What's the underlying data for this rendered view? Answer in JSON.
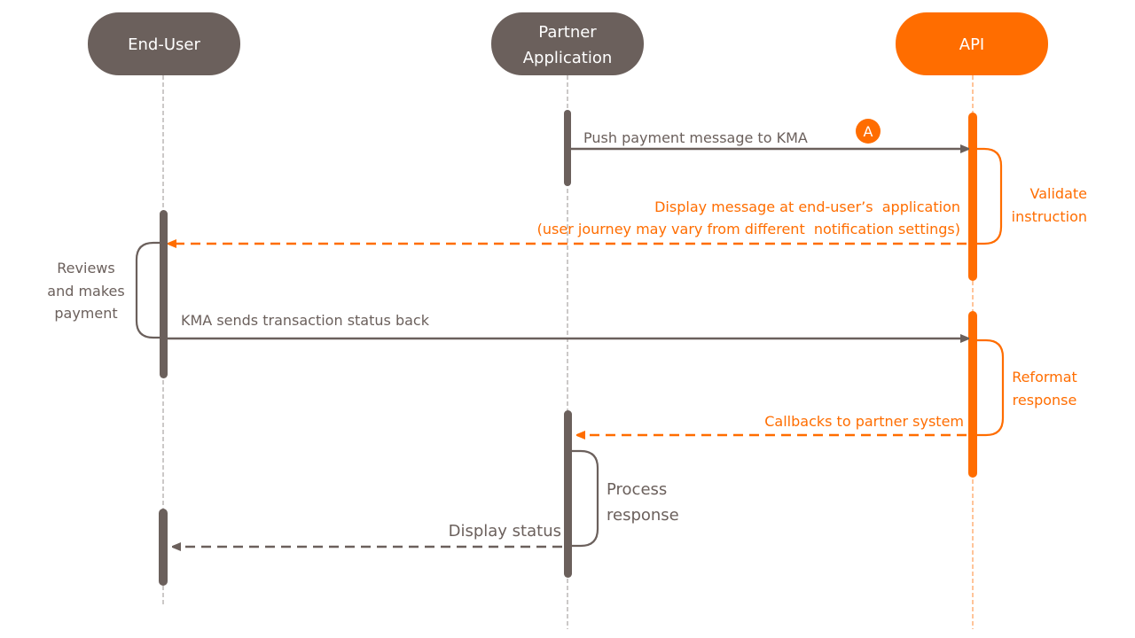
{
  "colors": {
    "gray": "#6b605c",
    "orange": "#ff6d00",
    "white": "#ffffff",
    "lifeline_gray": "#9a9390",
    "lifeline_orange": "#ff8a33"
  },
  "participants": [
    {
      "id": "end-user",
      "name_lines": [
        "End-User"
      ],
      "color": "#6b605c"
    },
    {
      "id": "partner-application",
      "name_lines": [
        "Partner",
        "Application"
      ],
      "color": "#6b605c"
    },
    {
      "id": "api",
      "name_lines": [
        "API"
      ],
      "color": "#ff6d00"
    }
  ],
  "messages": [
    {
      "id": "push-payment",
      "from": "partner-application",
      "to": "api",
      "style": "solid",
      "color": "#6b605c",
      "label_lines": [
        "Push payment message to KMA"
      ],
      "badge": "A"
    },
    {
      "id": "display-message",
      "from": "api",
      "to": "end-user",
      "style": "dashed",
      "color": "#ff6d00",
      "label_lines": [
        "Display message at end-user’s  application",
        "(user journey may vary from different  notification settings)"
      ]
    },
    {
      "id": "transaction-status",
      "from": "end-user",
      "to": "api",
      "style": "solid",
      "color": "#6b605c",
      "label_lines": [
        "KMA sends transaction status back"
      ]
    },
    {
      "id": "callbacks",
      "from": "api",
      "to": "partner-application",
      "style": "dashed",
      "color": "#ff6d00",
      "label_lines": [
        "Callbacks to partner system"
      ]
    },
    {
      "id": "display-status",
      "from": "partner-application",
      "to": "end-user",
      "style": "dashed",
      "color": "#6b605c",
      "label_lines": [
        "Display status"
      ]
    }
  ],
  "self_actions": [
    {
      "id": "validate-instruction",
      "participant": "api",
      "side": "right",
      "color": "#ff6d00",
      "label_lines": [
        "Validate",
        "instruction"
      ]
    },
    {
      "id": "reviews-payment",
      "participant": "end-user",
      "side": "left",
      "color": "#6b605c",
      "label_lines": [
        "Reviews",
        "and makes",
        "payment"
      ]
    },
    {
      "id": "reformat-response",
      "participant": "api",
      "side": "right",
      "color": "#ff6d00",
      "label_lines": [
        "Reformat",
        "response"
      ]
    },
    {
      "id": "process-response",
      "participant": "partner-application",
      "side": "right",
      "color": "#6b605c",
      "label_lines": [
        "Process",
        "response"
      ]
    }
  ]
}
